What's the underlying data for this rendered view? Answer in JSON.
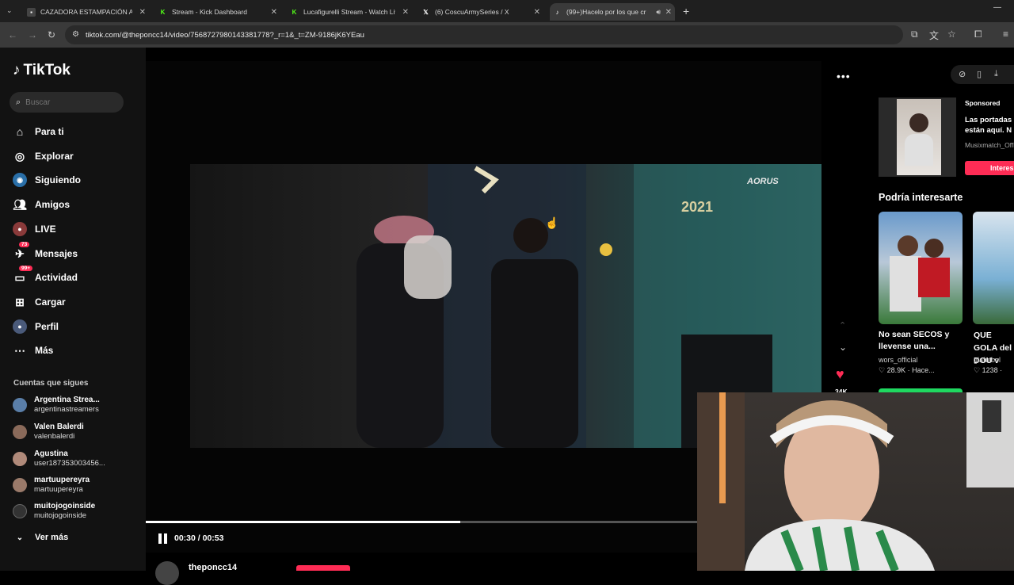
{
  "browser": {
    "tabs": [
      {
        "title": "CAZADORA ESTAMPACIÓN AB",
        "icon": "store-favicon"
      },
      {
        "title": "Stream - Kick Dashboard",
        "icon": "kick-favicon"
      },
      {
        "title": "Lucafigurelli Stream - Watch Liv",
        "icon": "kick-favicon"
      },
      {
        "title": "(6) CoscuArmySeries / X",
        "icon": "x-favicon"
      },
      {
        "title": "(99+)Hacelo por los que cr",
        "icon": "tiktok-favicon"
      }
    ],
    "url": "tiktok.com/@theponcc14/video/7568727980143381778?_r=1&_t=ZM-9186jK6YEau"
  },
  "tiktok": {
    "logo": "TikTok",
    "search_placeholder": "Buscar",
    "nav": [
      {
        "label": "Para ti",
        "icon": "home-icon"
      },
      {
        "label": "Explorar",
        "icon": "compass-icon"
      },
      {
        "label": "Siguiendo",
        "icon": "following-icon"
      },
      {
        "label": "Amigos",
        "icon": "friends-icon"
      },
      {
        "label": "LIVE",
        "icon": "live-icon"
      },
      {
        "label": "Mensajes",
        "icon": "messages-icon",
        "badge": "73"
      },
      {
        "label": "Actividad",
        "icon": "activity-icon",
        "badge": "99+"
      },
      {
        "label": "Cargar",
        "icon": "upload-icon"
      },
      {
        "label": "Perfil",
        "icon": "profile-icon"
      },
      {
        "label": "Más",
        "icon": "more-icon"
      }
    ],
    "following_title": "Cuentas que sigues",
    "following": [
      {
        "name": "Argentina Strea...",
        "user": "argentinastreamers"
      },
      {
        "name": "Valen Balerdi",
        "user": "valenbalerdi"
      },
      {
        "name": "Agustina",
        "user": "user187353003456..."
      },
      {
        "name": "martuupereyra",
        "user": "martuupereyra"
      },
      {
        "name": "muitojogoinside",
        "user": "muitojogoinside"
      }
    ],
    "see_more": "Ver más"
  },
  "player": {
    "time": "00:30 / 00:53",
    "progress": 0.57,
    "likes": "34K",
    "author": "theponcc14"
  },
  "right": {
    "sponsored_tag": "Sponsored",
    "sponsored_title": "Las portadas están aquí. N",
    "sponsored_author": "Musixmatch_Offi",
    "sponsored_cta": "Interes",
    "may_interest": "Podría interesarte",
    "cards": [
      {
        "title": "No sean SECOS y llevense una...",
        "author": "wors_official",
        "stats": "28.9K · Hace..."
      },
      {
        "title": "QUE GOLA del DOU v",
        "author": "glafutbol",
        "stats": "1238 ·"
      }
    ]
  },
  "colors": {
    "accent": "#fe2c55",
    "kick": "#53fc18"
  }
}
